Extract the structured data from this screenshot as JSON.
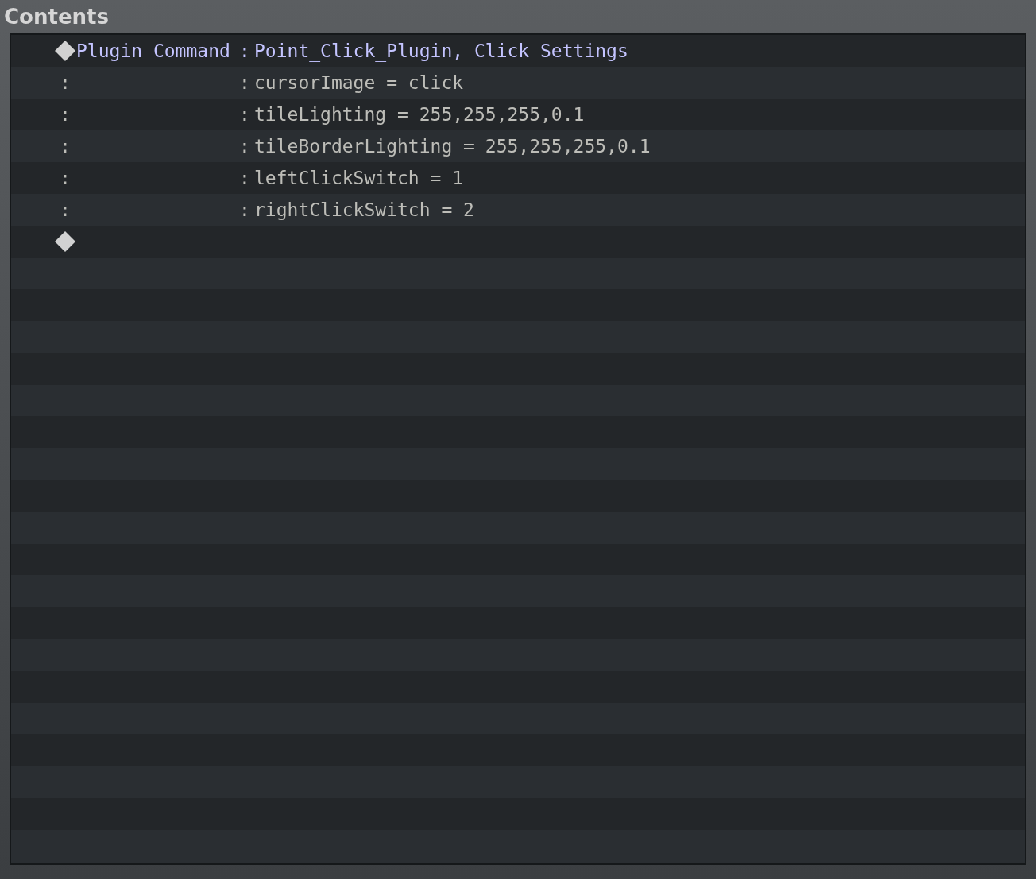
{
  "title": "Contents",
  "lines": [
    {
      "kind": "command",
      "label": "Plugin Command",
      "separator": ":",
      "value": "Point_Click_Plugin, Click Settings"
    },
    {
      "kind": "param",
      "marker": ":",
      "separator": ":",
      "value": "cursorImage = click"
    },
    {
      "kind": "param",
      "marker": ":",
      "separator": ":",
      "value": "tileLighting = 255,255,255,0.1"
    },
    {
      "kind": "param",
      "marker": ":",
      "separator": ":",
      "value": "tileBorderLighting = 255,255,255,0.1"
    },
    {
      "kind": "param",
      "marker": ":",
      "separator": ":",
      "value": "leftClickSwitch = 1"
    },
    {
      "kind": "param",
      "marker": ":",
      "separator": ":",
      "value": "rightClickSwitch = 2"
    },
    {
      "kind": "end"
    }
  ]
}
